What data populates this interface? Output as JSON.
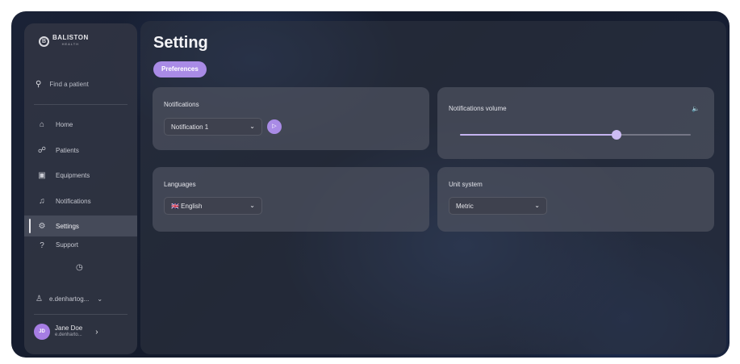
{
  "logo": {
    "title": "BALISTON",
    "subtitle": "HEALTH",
    "mark": "B"
  },
  "search": {
    "icon": "search-icon",
    "placeholder": "Find a patient"
  },
  "nav": {
    "items": [
      {
        "label": "Home",
        "icon": "home-icon",
        "glyph": "⌂"
      },
      {
        "label": "Patients",
        "icon": "patients-icon",
        "glyph": "☍"
      },
      {
        "label": "Equipments",
        "icon": "equipment-icon",
        "glyph": "▣"
      },
      {
        "label": "Notifications",
        "icon": "bell-icon",
        "glyph": "♫"
      },
      {
        "label": "Settings",
        "icon": "gear-icon",
        "glyph": "⚙"
      },
      {
        "label": "Support",
        "icon": "support-icon",
        "glyph": "?"
      }
    ],
    "active": "Settings"
  },
  "clock_glyph": "◷",
  "account": {
    "label": "e.denhartog...",
    "chevron": "⌄",
    "glyph": "♙"
  },
  "user": {
    "initials": "JD",
    "name": "Jane Doe",
    "email": "e.denharto...",
    "chevron": "›"
  },
  "page": {
    "title": "Setting",
    "tab": "Preferences"
  },
  "notifications": {
    "title": "Notifications",
    "selected": "Notification 1",
    "chevron": "⌄",
    "play_glyph": "▷"
  },
  "volume": {
    "title": "Notifications volume",
    "icon_glyph": "🔈",
    "level": 0.68
  },
  "languages": {
    "title": "Languages",
    "selected": "🇬🇧 English",
    "chevron": "⌄"
  },
  "units": {
    "title": "Unit system",
    "selected": "Metric",
    "chevron": "⌄"
  },
  "colors": {
    "accent": "#a98be6",
    "slider": "#c5b3f0"
  }
}
